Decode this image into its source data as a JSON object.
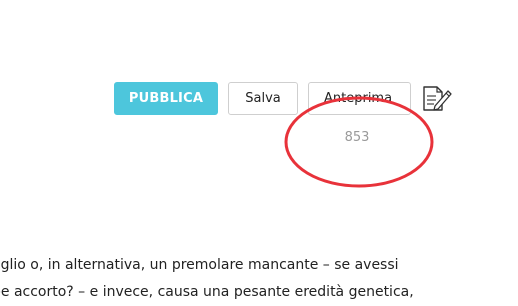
{
  "toolbar": {
    "publish_label": "PUBBLICA",
    "save_label": "Salva",
    "preview_label": "Anteprima",
    "edit_icon": "edit-document-icon",
    "word_count": "853"
  },
  "colors": {
    "publish_bg": "#4dc6dc",
    "annotation_stroke": "#e8323a"
  },
  "content": {
    "lines": [
      "eglio o, in alternativa, un premolare mancante –  se avessi",
      "be accorto? – e invece, causa una pesante eredità genetica,"
    ]
  }
}
